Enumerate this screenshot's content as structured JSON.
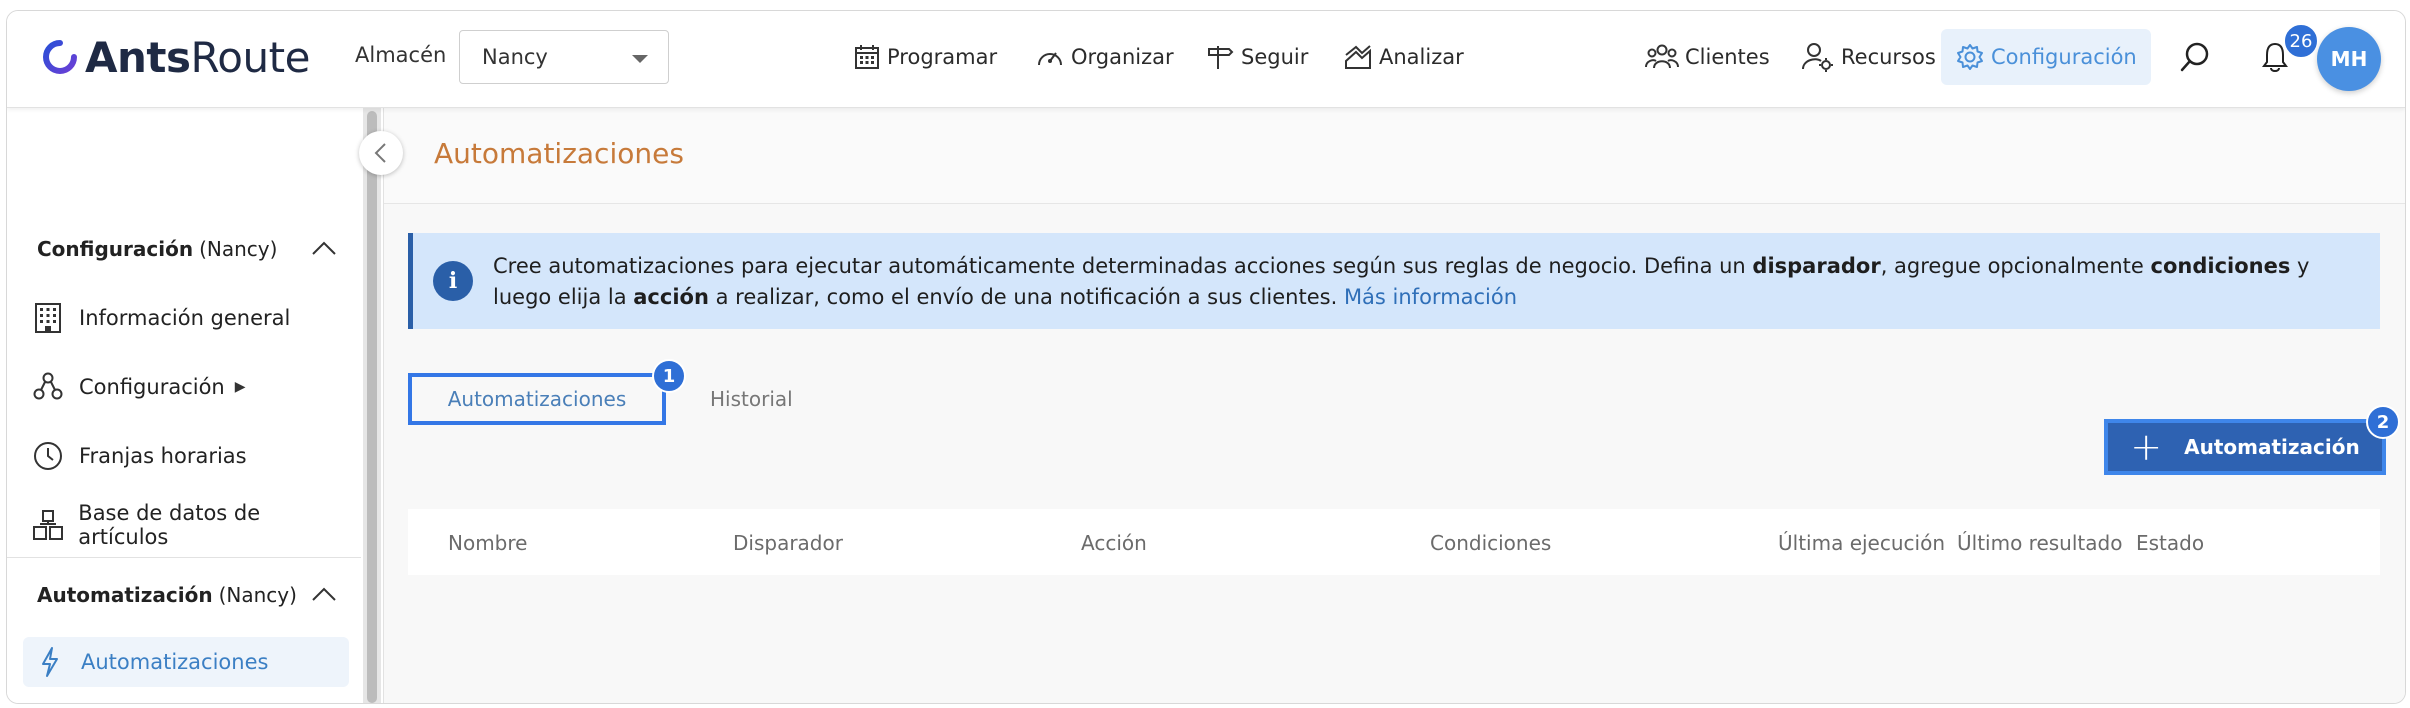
{
  "brand": {
    "name_bold": "Ants",
    "name_regular": "Route"
  },
  "header": {
    "warehouse_label": "Almacén",
    "warehouse_value": "Nancy",
    "nav": [
      {
        "label": "Programar",
        "icon": "calendar-icon"
      },
      {
        "label": "Organizar",
        "icon": "speedometer-icon"
      },
      {
        "label": "Seguir",
        "icon": "signpost-icon"
      },
      {
        "label": "Analizar",
        "icon": "chart-icon"
      }
    ],
    "right_nav": [
      {
        "label": "Clientes",
        "icon": "people-icon"
      },
      {
        "label": "Recursos",
        "icon": "user-gear-icon"
      },
      {
        "label": "Configuración",
        "icon": "gear-icon",
        "active": true
      }
    ],
    "notifications_count": "26",
    "avatar_initials": "MH"
  },
  "sidebar": {
    "section1": {
      "title": "Configuración",
      "context": "(Nancy)"
    },
    "items": [
      {
        "label": "Información general",
        "icon": "building-icon"
      },
      {
        "label": "Configuración",
        "suffix": "▶",
        "icon": "nodes-icon"
      },
      {
        "label": "Franjas horarias",
        "icon": "clock-icon"
      },
      {
        "label": "Base de datos de artículos",
        "icon": "boxes-icon"
      }
    ],
    "section2": {
      "title": "Automatización",
      "context": "(Nancy)"
    },
    "active_item": {
      "label": "Automatizaciones",
      "icon": "lightning-icon"
    }
  },
  "main": {
    "title": "Automatizaciones",
    "info": {
      "p1": "Cree automatizaciones para ejecutar automáticamente determinadas acciones según sus reglas de negocio. Defina un ",
      "b1": "disparador",
      "p2": ", agregue opcionalmente ",
      "b2": "condiciones",
      "p3": " y luego elija la ",
      "b3": "acción",
      "p4": " a realizar, como el envío de una notificación a sus clientes. ",
      "link": "Más información"
    },
    "tabs": [
      {
        "label": "Automatizaciones",
        "active": true
      },
      {
        "label": "Historial",
        "active": false
      }
    ],
    "step_markers": [
      "1",
      "2"
    ],
    "add_button_label": "Automatización",
    "columns": [
      "Nombre",
      "Disparador",
      "Acción",
      "Condiciones",
      "Última ejecución",
      "Último resultado",
      "Estado"
    ]
  },
  "colors": {
    "accent": "#2f6fd6",
    "title": "#c77a3a",
    "info_bg": "#d4e6fb",
    "button": "#2e62b2"
  }
}
